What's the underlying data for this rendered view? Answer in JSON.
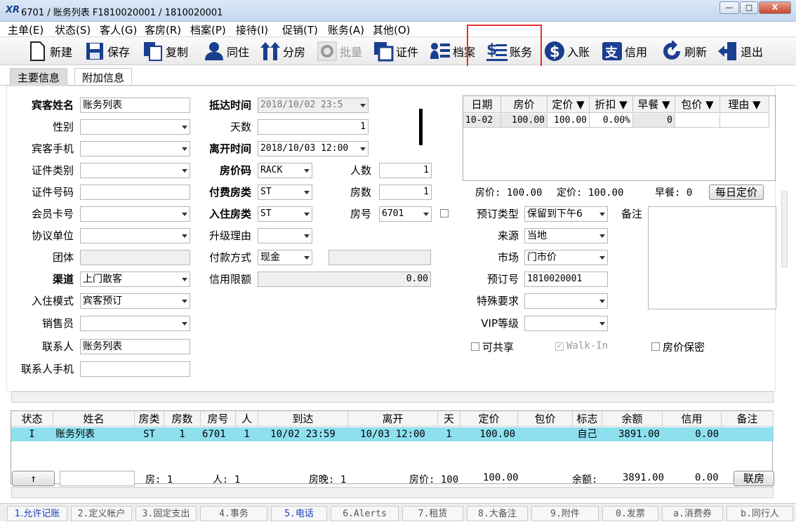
{
  "window": {
    "logo": "XR",
    "title": "6701 / 账务列表 F1810020001 / 1810020001",
    "min": "—",
    "max": "□",
    "close": "X"
  },
  "menu": [
    "主单(E)",
    "状态(S)",
    "客人(G)",
    "客房(R)",
    "档案(P)",
    "接待(I)",
    "促销(T)",
    "账务(A)",
    "其他(O)"
  ],
  "toolbar": {
    "new": "新建",
    "save": "保存",
    "copy": "复制",
    "cohabit": "同住",
    "split": "分房",
    "batch": "批量",
    "cert": "证件",
    "archive": "档案",
    "account": "账务",
    "posting": "入账",
    "credit": "信用",
    "refresh": "刷新",
    "exit": "退出"
  },
  "tabs": {
    "main": "主要信息",
    "extra": "附加信息"
  },
  "form": {
    "guest_name_label": "宾客姓名",
    "guest_name": "账务列表",
    "gender_label": "性别",
    "mobile_label": "宾客手机",
    "id_type_label": "证件类别",
    "id_no_label": "证件号码",
    "member_label": "会员卡号",
    "company_label": "协议单位",
    "group_label": "团体",
    "channel_label": "渠道",
    "channel": "上门散客",
    "checkin_mode_label": "入住模式",
    "checkin_mode": "宾客预订",
    "sales_label": "销售员",
    "contact_label": "联系人",
    "contact": "账务列表",
    "contact_mobile_label": "联系人手机",
    "arrival_label": "抵达时间",
    "arrival": "2018/10/02 23:5",
    "days_label": "天数",
    "days": "1",
    "departure_label": "离开时间",
    "departure": "2018/10/03 12:00",
    "rate_code_label": "房价码",
    "rate_code": "RACK",
    "persons_label": "人数",
    "persons": "1",
    "pay_room_type_label": "付费房类",
    "pay_room_type": "ST",
    "rooms_label": "房数",
    "rooms": "1",
    "room_type_label": "入住房类",
    "room_type": "ST",
    "room_no_label": "房号",
    "room_no": "6701",
    "upgrade_label": "升级理由",
    "payment_label": "付款方式",
    "payment": "现金",
    "credit_limit_label": "信用限额",
    "credit_limit": "0.00",
    "booking_type_label": "预订类型",
    "booking_type": "保留到下午6",
    "source_label": "来源",
    "source": "当地",
    "market_label": "市场",
    "market": "门市价",
    "booking_no_label": "预订号",
    "booking_no": "1810020001",
    "special_label": "特殊要求",
    "vip_label": "VIP等级",
    "remark_label": "备注",
    "shareable": "可共享",
    "walkin": "Walk-In",
    "rate_secret": "房价保密"
  },
  "rate_grid": {
    "headers": [
      "日期",
      "房价",
      "定价 ▼",
      "折扣 ▼",
      "早餐 ▼",
      "包价 ▼",
      "理由 ▼"
    ],
    "row": [
      "10-02",
      "100.00",
      "100.00",
      "0.00%",
      "0",
      "",
      ""
    ]
  },
  "rate_summary": {
    "room_rate": "房价: 100.00",
    "fixed_rate": "定价: 100.00",
    "breakfast": "早餐: 0",
    "daily_btn": "每日定价"
  },
  "list": {
    "headers": [
      "状态",
      "姓名",
      "房类",
      "房数",
      "房号",
      "人",
      "到达",
      "离开",
      "天",
      "定价",
      "包价",
      "标志",
      "余额",
      "信用",
      "备注"
    ],
    "row": [
      "I",
      "账务列表",
      "ST",
      "1",
      "6701",
      "1",
      "10/02 23:59",
      "10/03 12:00",
      "1",
      "100.00",
      "",
      "自己",
      "3891.00",
      "0.00",
      ""
    ]
  },
  "totals": {
    "up": "↑",
    "rooms": "房:  1",
    "persons": "人:  1",
    "nights": "房晚: 1",
    "rate": "房价: 100",
    "rate_sum": "100.00",
    "balance_label": "余额:",
    "balance": "3891.00",
    "credit": "0.00",
    "share_btn": "联房"
  },
  "bottom_tabs": [
    "1.允许记账",
    "2.定义帐户",
    "3.固定支出",
    "4.事务",
    "5.电话",
    "6.Alerts",
    "7.租赁",
    "8.大备注",
    "9.附件",
    "0.发票",
    "a.消费券",
    "b.同行人"
  ],
  "colors": {
    "accent": "#1a5fa8",
    "highlight_row": "#8ee0ef",
    "red_box": "#e53030"
  }
}
